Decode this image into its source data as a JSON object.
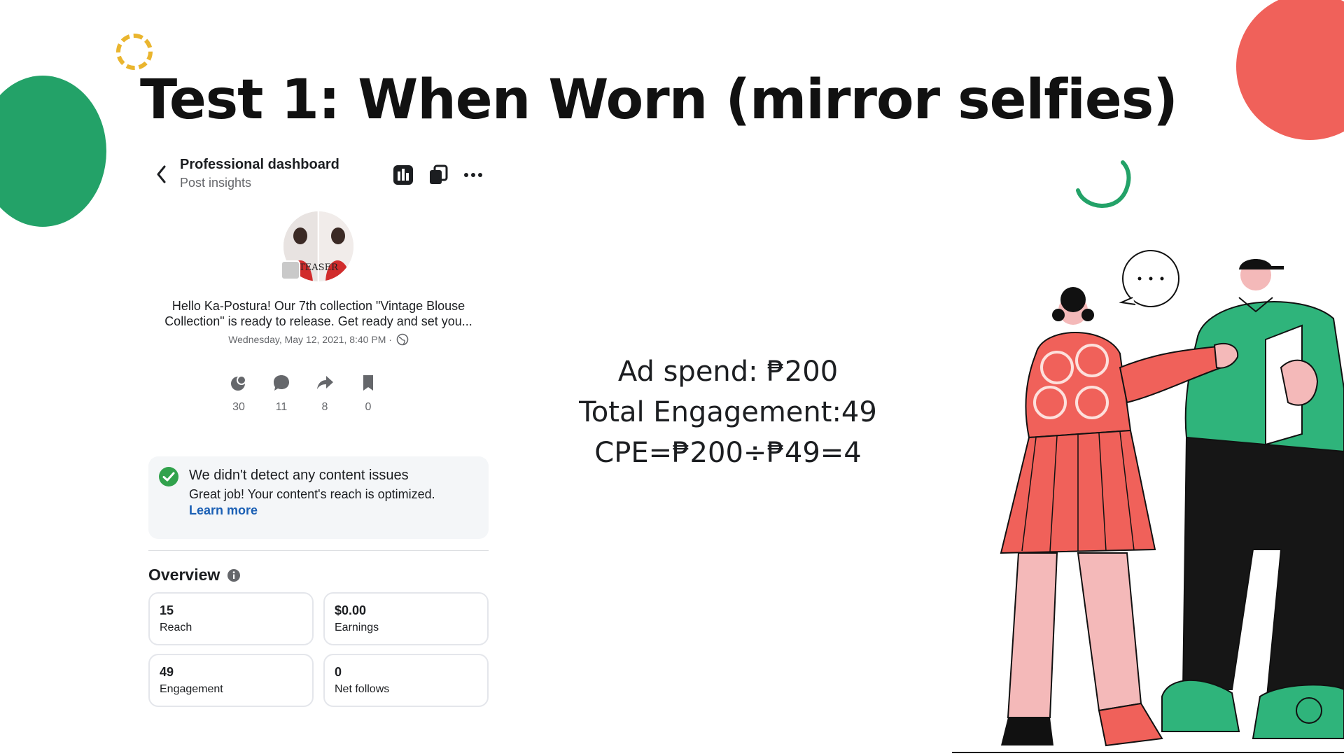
{
  "slide": {
    "title": "Test 1: When Worn (mirror selfies)"
  },
  "header": {
    "title": "Professional dashboard",
    "subtitle": "Post insights"
  },
  "post": {
    "text_line1": "Hello Ka-Postura! Our 7th collection \"Vintage Blouse",
    "text_line2": "Collection\" is ready to release. Get ready and set you...",
    "date": "Wednesday, May 12, 2021, 8:40 PM ·"
  },
  "stats": [
    {
      "icon": "reactions-icon",
      "value": "30"
    },
    {
      "icon": "comment-icon",
      "value": "11"
    },
    {
      "icon": "share-icon",
      "value": "8"
    },
    {
      "icon": "bookmark-icon",
      "value": "0"
    }
  ],
  "notice": {
    "title": "We didn't detect any content issues",
    "body": "Great job! Your content's reach is optimized.",
    "link": "Learn more"
  },
  "overview": {
    "title": "Overview",
    "cards": [
      {
        "value": "15",
        "label": "Reach"
      },
      {
        "value": "$0.00",
        "label": "Earnings"
      },
      {
        "value": "49",
        "label": "Engagement"
      },
      {
        "value": "0",
        "label": "Net follows"
      }
    ]
  },
  "metrics": {
    "line1": "Ad spend: ₱200",
    "line2": "Total Engagement:49",
    "line3": "CPE=₱200÷₱49=4"
  },
  "colors": {
    "green": "#23a268",
    "red": "#f0615a",
    "yellow": "#eab52e",
    "link_blue": "#1a5fb4",
    "check_green": "#31a24c"
  }
}
